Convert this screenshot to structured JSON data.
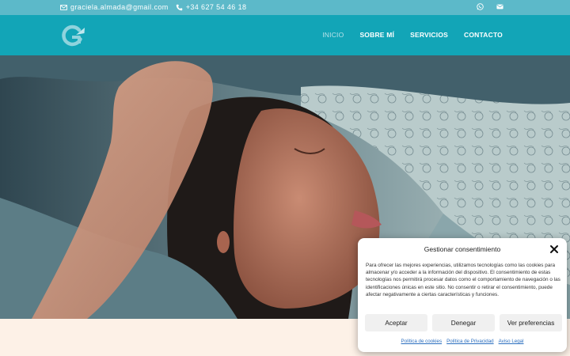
{
  "topbar": {
    "email": "graciela.almada@gmail.com",
    "phone": "+34 627 54 46 18",
    "icons": [
      "envelope-icon",
      "phone-icon",
      "whatsapp-icon",
      "mail-icon"
    ]
  },
  "header": {
    "logo": "G",
    "nav": [
      "INICIO",
      "SOBRE MÍ",
      "SERVICIOS",
      "CONTACTO"
    ],
    "active": "INICIO"
  },
  "hero": {
    "image": "woman-resting-under-scarf"
  },
  "consent": {
    "title": "Gestionar consentimiento",
    "body": "Para ofrecer las mejores experiencias, utilizamos tecnologías como las cookies para almacenar y/o acceder a la información del dispositivo. El consentimiento de estas tecnologías nos permitirá procesar datos como el comportamiento de navegación o las identificaciones únicas en este sitio. No consentir o retirar el consentimiento, puede afectar negativamente a ciertas características y funciones.",
    "buttons": {
      "accept": "Aceptar",
      "deny": "Denegar",
      "preferences": "Ver preferencias"
    },
    "links": {
      "cookies": "Política de cookies",
      "privacy": "Política de Privacidad",
      "legal": "Aviso Legal"
    }
  },
  "colors": {
    "topbar": "#5cb9c9",
    "header": "#12a5b7",
    "link": "#2a6ebf",
    "band": "#fdf1e7"
  }
}
